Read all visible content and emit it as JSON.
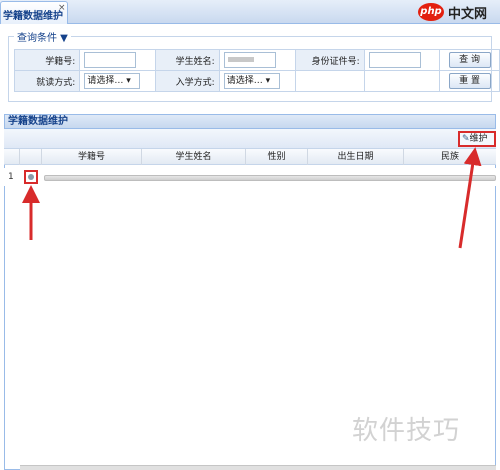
{
  "tab": {
    "title": "学籍数据维护",
    "close_glyph": "×"
  },
  "brand": {
    "logo_text": "php",
    "site_text": "中文网"
  },
  "query": {
    "legend": "查询条件 ▼",
    "student_no_label": "学籍号:",
    "student_name_label": "学生姓名:",
    "id_card_label": "身份证件号:",
    "study_mode_label": "就读方式:",
    "study_mode_value": "请选择… ▾",
    "enroll_mode_label": "入学方式:",
    "enroll_mode_value": "请选择… ▾",
    "search_button": "查 询",
    "reset_button": "重 置"
  },
  "grid": {
    "title": "学籍数据维护",
    "maintain_button": "维护",
    "maintain_icon": "edit-icon",
    "columns": [
      "学籍号",
      "学生姓名",
      "性别",
      "出生日期",
      "民族"
    ],
    "rows": [
      {
        "row_number": "1"
      }
    ]
  },
  "watermark": "软件技巧",
  "colors": {
    "annotation_red": "#d82b2b",
    "header_blue": "#15428b",
    "border_blue": "#99bbe8"
  }
}
